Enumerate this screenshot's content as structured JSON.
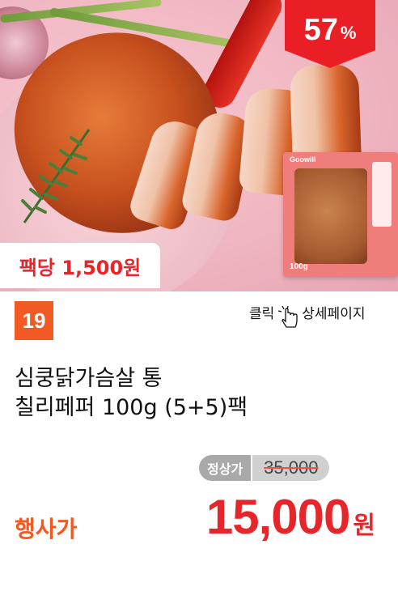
{
  "badge": {
    "discount_value": "57",
    "discount_unit": "%"
  },
  "hero": {
    "pack_price": "팩당 1,500원"
  },
  "package": {
    "logo": "Goowill",
    "weight": "100g"
  },
  "product": {
    "rank": "19",
    "detail_left": "클릭",
    "detail_right": "상세페이지",
    "title_line1": "심쿵닭가슴살 통",
    "title_line2": "칠리페퍼 100g (5+5)팩"
  },
  "pricing": {
    "regular_label": "정상가",
    "regular_price": "35,000",
    "event_label": "행사가",
    "event_price": "15,000",
    "event_unit": "원"
  },
  "colors": {
    "accent_red": "#e7262b",
    "accent_orange": "#f15a22",
    "badge_red": "#ea1f25"
  }
}
